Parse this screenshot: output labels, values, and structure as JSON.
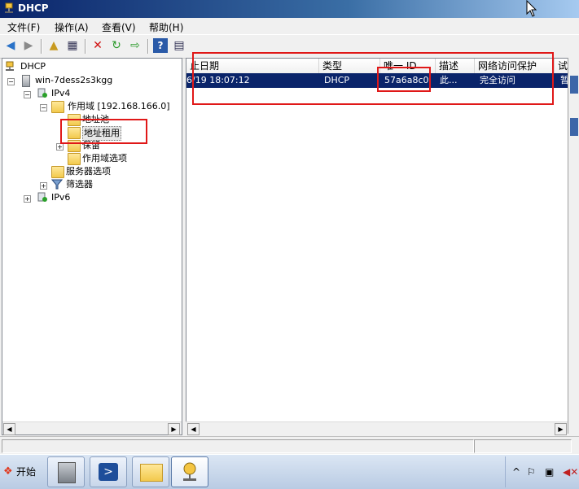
{
  "window": {
    "title": "DHCP"
  },
  "menu": [
    "文件(F)",
    "操作(A)",
    "查看(V)",
    "帮助(H)"
  ],
  "toolbar": {
    "buttons": [
      "back-icon",
      "forward-icon",
      "up-folder-icon",
      "show-hide-tree-icon",
      "delete-icon",
      "refresh-icon",
      "export-icon",
      "help-icon",
      "properties-icon"
    ]
  },
  "tree": {
    "root": "DHCP",
    "server": "win-7dess2s3kgg",
    "ipv4": "IPv4",
    "scope": "作用域 [192.168.166.0]",
    "pool": "地址池",
    "leases": "地址租用",
    "reservations": "保留",
    "scope_options": "作用域选项",
    "server_options": "服务器选项",
    "filters": "筛选器",
    "ipv6": "IPv6"
  },
  "list": {
    "columns": [
      "止日期",
      "类型",
      "唯一 ID",
      "描述",
      "网络访问保护",
      "试"
    ],
    "rows": [
      {
        "expiry": "6/19 18:07:12",
        "type": "DHCP",
        "uid": "57a6a8c0",
        "desc": "此...",
        "nap": "完全访问",
        "trial": "暂"
      }
    ]
  },
  "taskbar": {
    "start_label": "开始"
  },
  "colors": {
    "selection": "#0a246a",
    "annotation": "#e01818",
    "titlebar": "#0a246a"
  }
}
